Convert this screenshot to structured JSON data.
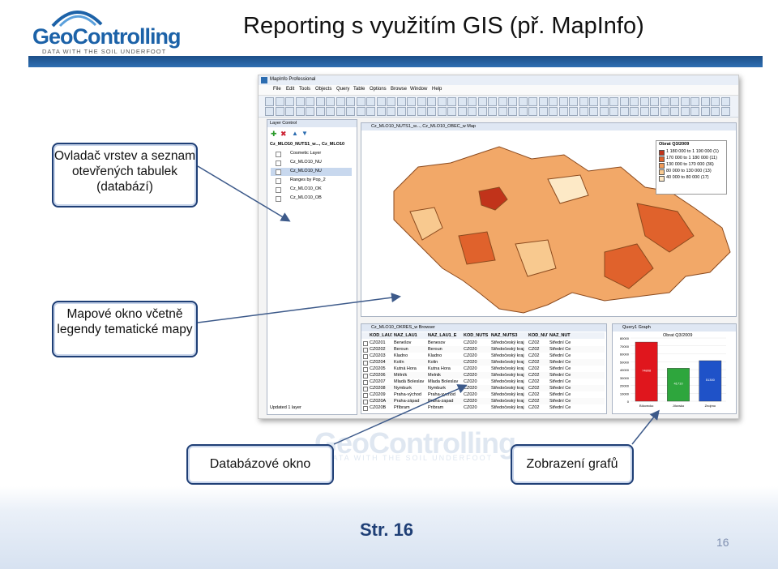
{
  "header": {
    "logo_geo": "Geo",
    "logo_controlling": "Controlling",
    "logo_tagline": "DATA WITH THE SOIL UNDERFOOT",
    "title": "Reporting s využitím GIS (př. MapInfo)"
  },
  "app": {
    "window_title": "MapInfo Professional",
    "menu": [
      "File",
      "Edit",
      "Tools",
      "Objects",
      "Query",
      "Table",
      "Options",
      "Browse",
      "Window",
      "Help"
    ]
  },
  "layer_control": {
    "title": "Layer Control",
    "header_text": "Cz_MLO10_NUTS1_w..., Cz_MLO10",
    "layers": [
      "Cosmetic Layer",
      "Cz_MLO10_NU",
      "Cz_MLO10_NU",
      "Ranges by Pop_2",
      "Cz_MLO10_OK",
      "Cz_MLO10_OB"
    ],
    "status": "Updated 1 layer"
  },
  "map_window": {
    "title": "Cz_MLO10_NUTS1_w..., Cz_MLO10_OBEC_w Map"
  },
  "legend": {
    "title": "Obrat Q3/2009",
    "items": [
      {
        "range": "1 180 000 to 1 190 000",
        "count": "(1)",
        "color": "#c1331a"
      },
      {
        "range": "170 000 to 1 180 000",
        "count": "(11)",
        "color": "#e0622c"
      },
      {
        "range": "130 000 to 170 000",
        "count": "(36)",
        "color": "#f09a57"
      },
      {
        "range": "80 000 to 130 000",
        "count": "(13)",
        "color": "#f8c98f"
      },
      {
        "range": "40 000 to 80 000",
        "count": "(17)",
        "color": "#fde9c6"
      }
    ]
  },
  "browser": {
    "title": "Cz_MLO10_OKRES_w Browser",
    "columns": [
      "KOD_LAU1",
      "NAZ_LAU1",
      "NAZ_LAU1_E",
      "KOD_NUTS",
      "NAZ_NUTS3",
      "KOD_NUTS",
      "NAZ_NUT"
    ],
    "rows": [
      [
        "CZ0201",
        "Benešov",
        "Benesov",
        "CZ020",
        "Středočeský kraj",
        "CZ02",
        "Střední Če"
      ],
      [
        "CZ0202",
        "Beroun",
        "Beroun",
        "CZ020",
        "Středočeský kraj",
        "CZ02",
        "Střední Če"
      ],
      [
        "CZ0203",
        "Kladno",
        "Kladno",
        "CZ020",
        "Středočeský kraj",
        "CZ02",
        "Střední Če"
      ],
      [
        "CZ0204",
        "Kolín",
        "Kolin",
        "CZ020",
        "Středočeský kraj",
        "CZ02",
        "Střední Če"
      ],
      [
        "CZ0205",
        "Kutná Hora",
        "Kutna Hora",
        "CZ020",
        "Středočeský kraj",
        "CZ02",
        "Střední Če"
      ],
      [
        "CZ0206",
        "Mělník",
        "Melnik",
        "CZ020",
        "Středočeský kraj",
        "CZ02",
        "Střední Če"
      ],
      [
        "CZ0207",
        "Mladá Boleslav",
        "Mlada Boleslav",
        "CZ020",
        "Středočeský kraj",
        "CZ02",
        "Střední Če"
      ],
      [
        "CZ0208",
        "Nymburk",
        "Nymburk",
        "CZ020",
        "Středočeský kraj",
        "CZ02",
        "Střední Če"
      ],
      [
        "CZ0209",
        "Praha-východ",
        "Praha-vychod",
        "CZ020",
        "Středočeský kraj",
        "CZ02",
        "Střední Če"
      ],
      [
        "CZ020A",
        "Praha-západ",
        "Praha-zapad",
        "CZ020",
        "Středočeský kraj",
        "CZ02",
        "Střední Če"
      ],
      [
        "CZ020B",
        "Příbram",
        "Pribram",
        "CZ020",
        "Středočeský kraj",
        "CZ02",
        "Střední Če"
      ]
    ]
  },
  "graph": {
    "title": "Query1 Graph",
    "chart_title": "Obrat Q3/2009",
    "categories": [
      "Bílovecko",
      "Jílovsko",
      "Znojmo"
    ],
    "values": [
      74808,
      41710,
      51300
    ],
    "bar_labels": [
      "74808",
      "41710",
      "51300"
    ],
    "colors": [
      "#e0161d",
      "#2ea63d",
      "#1f52c8"
    ],
    "y_ticks": [
      "0",
      "10000",
      "20000",
      "30000",
      "40000",
      "50000",
      "60000",
      "70000",
      "80000"
    ]
  },
  "callouts": {
    "layers": "Ovladač vrstev a seznam otevřených tabulek (databází)",
    "map": "Mapové okno včetně legendy tematické mapy",
    "database": "Databázové okno",
    "charts": "Zobrazení grafů"
  },
  "footer": {
    "page_label": "Str. 16",
    "slide_number": "16"
  }
}
